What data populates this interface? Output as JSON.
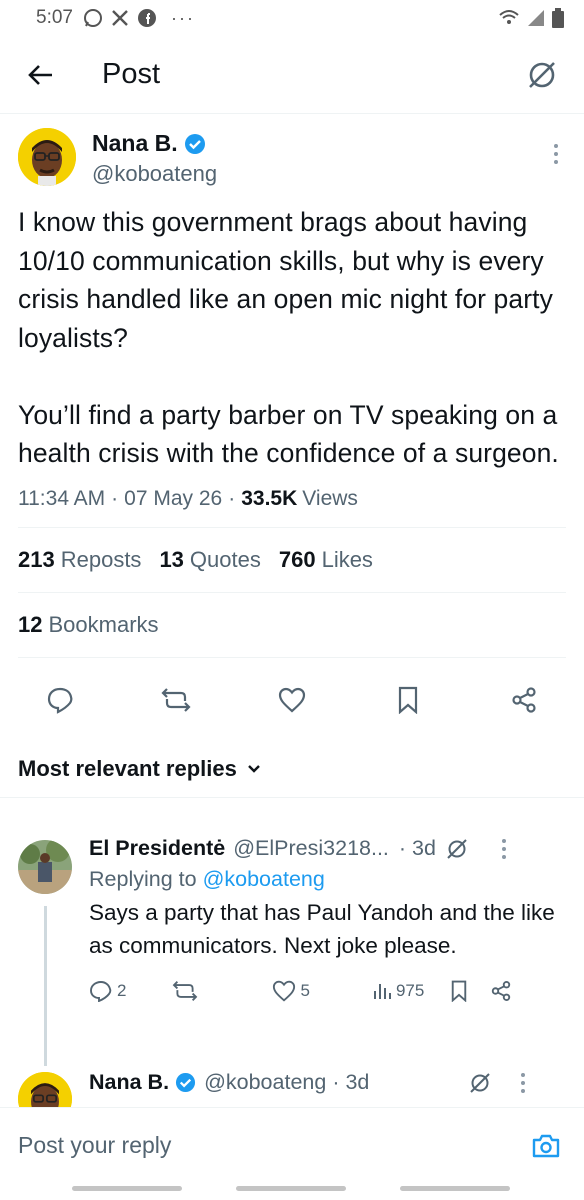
{
  "status_bar": {
    "time": "5:07",
    "left_icons": [
      "whatsapp-icon",
      "x-logo-icon",
      "facebook-icon",
      "more-notifications-icon"
    ],
    "right_icons": [
      "wifi-icon",
      "signal-icon",
      "battery-icon"
    ]
  },
  "header": {
    "title": "Post",
    "back_icon": "arrow-left-icon",
    "grok_icon": "grok-icon"
  },
  "post": {
    "author_name": "Nana B.",
    "author_handle": "@koboateng",
    "verified": true,
    "text": "I know this government brags about having 10/10 communication skills, but why is every crisis handled like an open mic night for party loyalists?\n\nYou’ll find a party barber on TV speaking on a health crisis with the confidence of a surgeon.",
    "time": "11:34 AM",
    "date": "07 May 26",
    "views_count": "33.5K",
    "views_label": "Views",
    "reposts_count": "213",
    "reposts_label": "Reposts",
    "quotes_count": "13",
    "quotes_label": "Quotes",
    "likes_count": "760",
    "likes_label": "Likes",
    "bookmarks_count": "12",
    "bookmarks_label": "Bookmarks"
  },
  "replies_heading": "Most relevant replies",
  "replies": [
    {
      "name": "El Presidentė",
      "handle": "@ElPresi3218...",
      "time": "· 3d",
      "replying_prefix": "Replying to",
      "replying_handle": "@koboateng",
      "text": "Says a party that has Paul Yandoh and the like as communicators. Next joke please.",
      "replies_count": "2",
      "reposts_count": "",
      "likes_count": "5",
      "views_count": "975"
    },
    {
      "name": "Nana B.",
      "handle": "@koboateng",
      "time": "· 3d",
      "verified": true
    }
  ],
  "reply_bar": {
    "placeholder": "Post your reply"
  },
  "colors": {
    "accent": "#1d9bf0",
    "text": "#0f1419",
    "muted": "#536471",
    "border": "#eff3f4",
    "avatar_bg": "#f4d000"
  }
}
